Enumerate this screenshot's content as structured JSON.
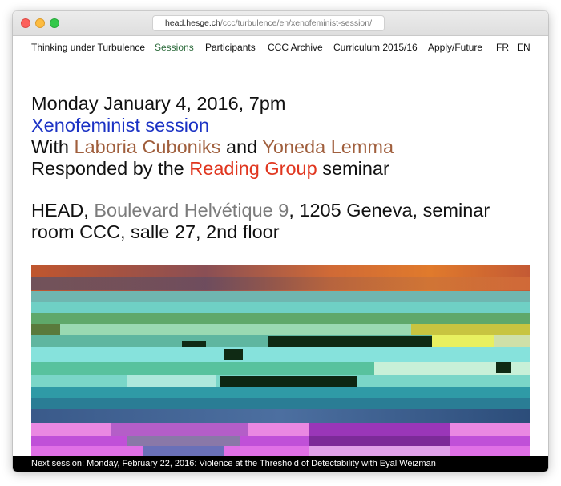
{
  "browser": {
    "url_host": "head.hesge.ch",
    "url_path": "/ccc/turbulence/en/xenofeminist-session/"
  },
  "nav": {
    "items": [
      "Thinking under Turbulence",
      "Sessions",
      "Participants",
      "CCC Archive",
      "Curriculum 2015/16",
      "Apply/Future"
    ],
    "active": "Sessions",
    "languages": [
      "FR",
      "EN"
    ]
  },
  "event": {
    "date": "Monday January 4, 2016, 7pm",
    "title": "Xenofeminist session",
    "with_prefix": "With",
    "guest_1": "Laboria Cuboniks",
    "with_and": "and",
    "guest_2": "Yoneda Lemma",
    "responded_prefix": "Responded by the",
    "responder": "Reading Group",
    "responded_suffix": "seminar",
    "venue": "HEAD,",
    "address": "Boulevard Helvétique 9",
    "location_rest": ", 1205 Geneva, seminar",
    "location_line2": "room CCC, salle 27, 2nd floor"
  },
  "footer": {
    "next_session": "Next session: Monday, February 22, 2016: Violence at the Threshold of Detectability with Eyal Weizman"
  },
  "colors": {
    "title_blue": "#1b32c4",
    "guest_brown": "#a05f3d",
    "responder_red": "#e0351e",
    "address_grey": "#7b7b7b",
    "nav_active_green": "#2d6b3c"
  },
  "image": {
    "description_icon": "glitch-art-image"
  }
}
